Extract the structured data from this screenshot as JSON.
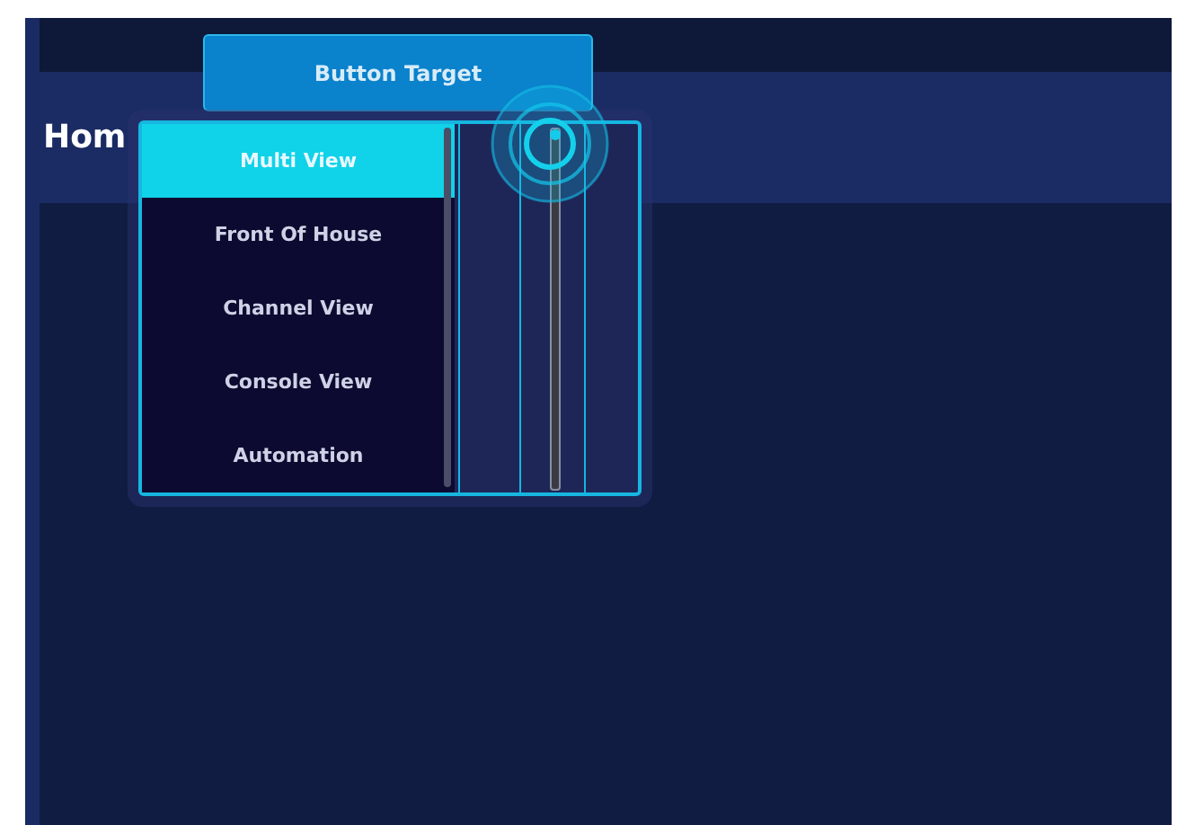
{
  "header": {
    "title": "Hom"
  },
  "target_button": {
    "label": "Button Target"
  },
  "dropdown": {
    "items": [
      {
        "label": "Multi View",
        "selected": true
      },
      {
        "label": "Front Of House",
        "selected": false
      },
      {
        "label": "Channel View",
        "selected": false
      },
      {
        "label": "Console View",
        "selected": false
      },
      {
        "label": "Automation",
        "selected": false
      }
    ]
  },
  "slider": {
    "level": 1
  }
}
